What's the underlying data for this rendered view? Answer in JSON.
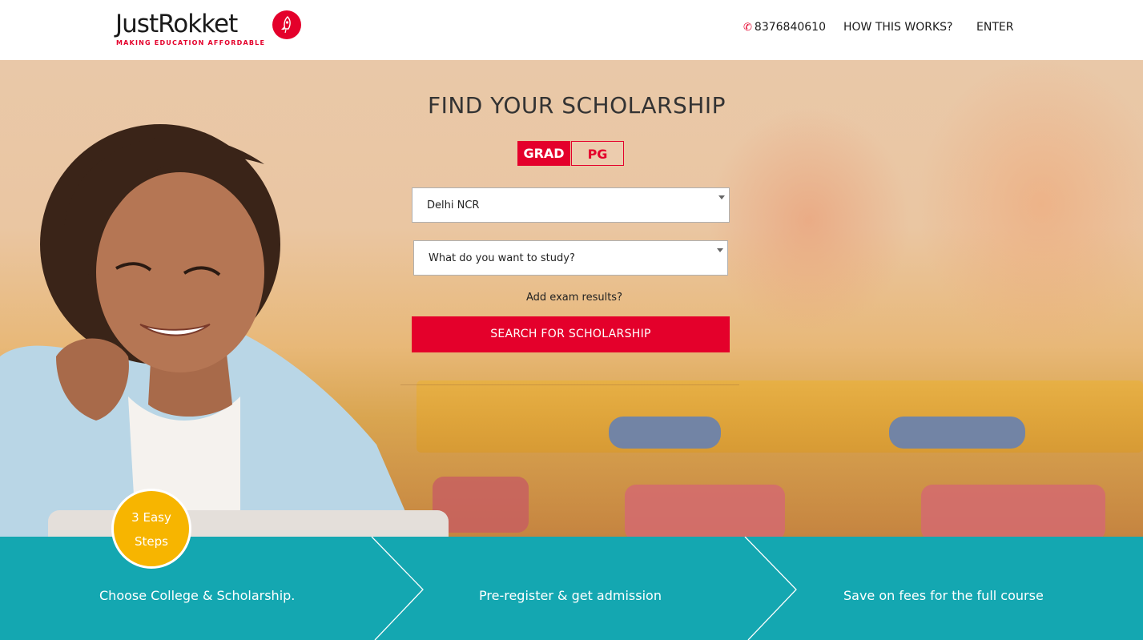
{
  "brand": {
    "name": "JustRokket",
    "tagline": "MAKING EDUCATION AFFORDABLE",
    "accent_color": "#e4002b",
    "teal_color": "#14a7b1",
    "yellow_color": "#f7b500"
  },
  "nav": {
    "phone_icon": "phone-icon",
    "phone": "8376840610",
    "how_label": "HOW THIS WORKS?",
    "enter_label": "ENTER"
  },
  "hero": {
    "title": "FIND YOUR SCHOLARSHIP",
    "tabs": [
      {
        "label": "GRAD",
        "selected": true
      },
      {
        "label": "PG",
        "selected": false
      }
    ],
    "city_select": {
      "value": "Delhi NCR"
    },
    "study_select": {
      "placeholder": "What do you want to study?"
    },
    "exam_link": "Add exam results?",
    "search_button": "SEARCH FOR SCHOLARSHIP"
  },
  "steps": {
    "badge_line1": "3 Easy",
    "badge_line2": "Steps",
    "items": [
      {
        "label": "Choose College & Scholarship."
      },
      {
        "label": "Pre-register & get admission"
      },
      {
        "label": "Save on fees for the full course"
      }
    ]
  }
}
